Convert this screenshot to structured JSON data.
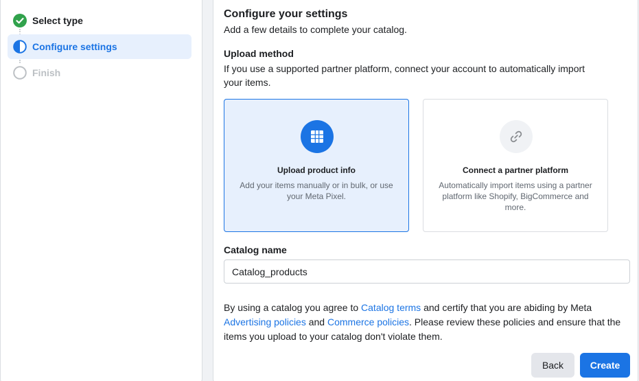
{
  "steps": [
    {
      "label": "Select type",
      "state": "complete",
      "icon": "check-circle-icon"
    },
    {
      "label": "Configure settings",
      "state": "current",
      "icon": "half-circle-icon"
    },
    {
      "label": "Finish",
      "state": "pending",
      "icon": "empty-circle-icon"
    }
  ],
  "main": {
    "title": "Configure your settings",
    "subtitle": "Add a few details to complete your catalog."
  },
  "upload_method": {
    "label": "Upload method",
    "description": "If you use a supported partner platform, connect your account to automatically import your items.",
    "options": [
      {
        "title": "Upload product info",
        "description": "Add your items manually or in bulk, or use your Meta Pixel.",
        "icon": "grid-icon",
        "selected": true
      },
      {
        "title": "Connect a partner platform",
        "description": "Automatically import items using a partner platform like Shopify, BigCommerce and more.",
        "icon": "link-icon",
        "selected": false
      }
    ]
  },
  "catalog_name": {
    "label": "Catalog name",
    "value": "Catalog_products"
  },
  "terms": {
    "part1": "By using a catalog you agree to ",
    "link_catalog_terms": "Catalog terms",
    "part2": " and certify that you are abiding by Meta ",
    "link_advertising": "Advertising policies",
    "part3": " and ",
    "link_commerce": "Commerce policies",
    "part4": ". Please review these policies and ensure that the items you upload to your catalog don't violate them."
  },
  "buttons": {
    "back": "Back",
    "create": "Create"
  },
  "colors": {
    "accent": "#1b74e4",
    "success": "#31a24c",
    "selected_bg": "#e7f0fd"
  }
}
